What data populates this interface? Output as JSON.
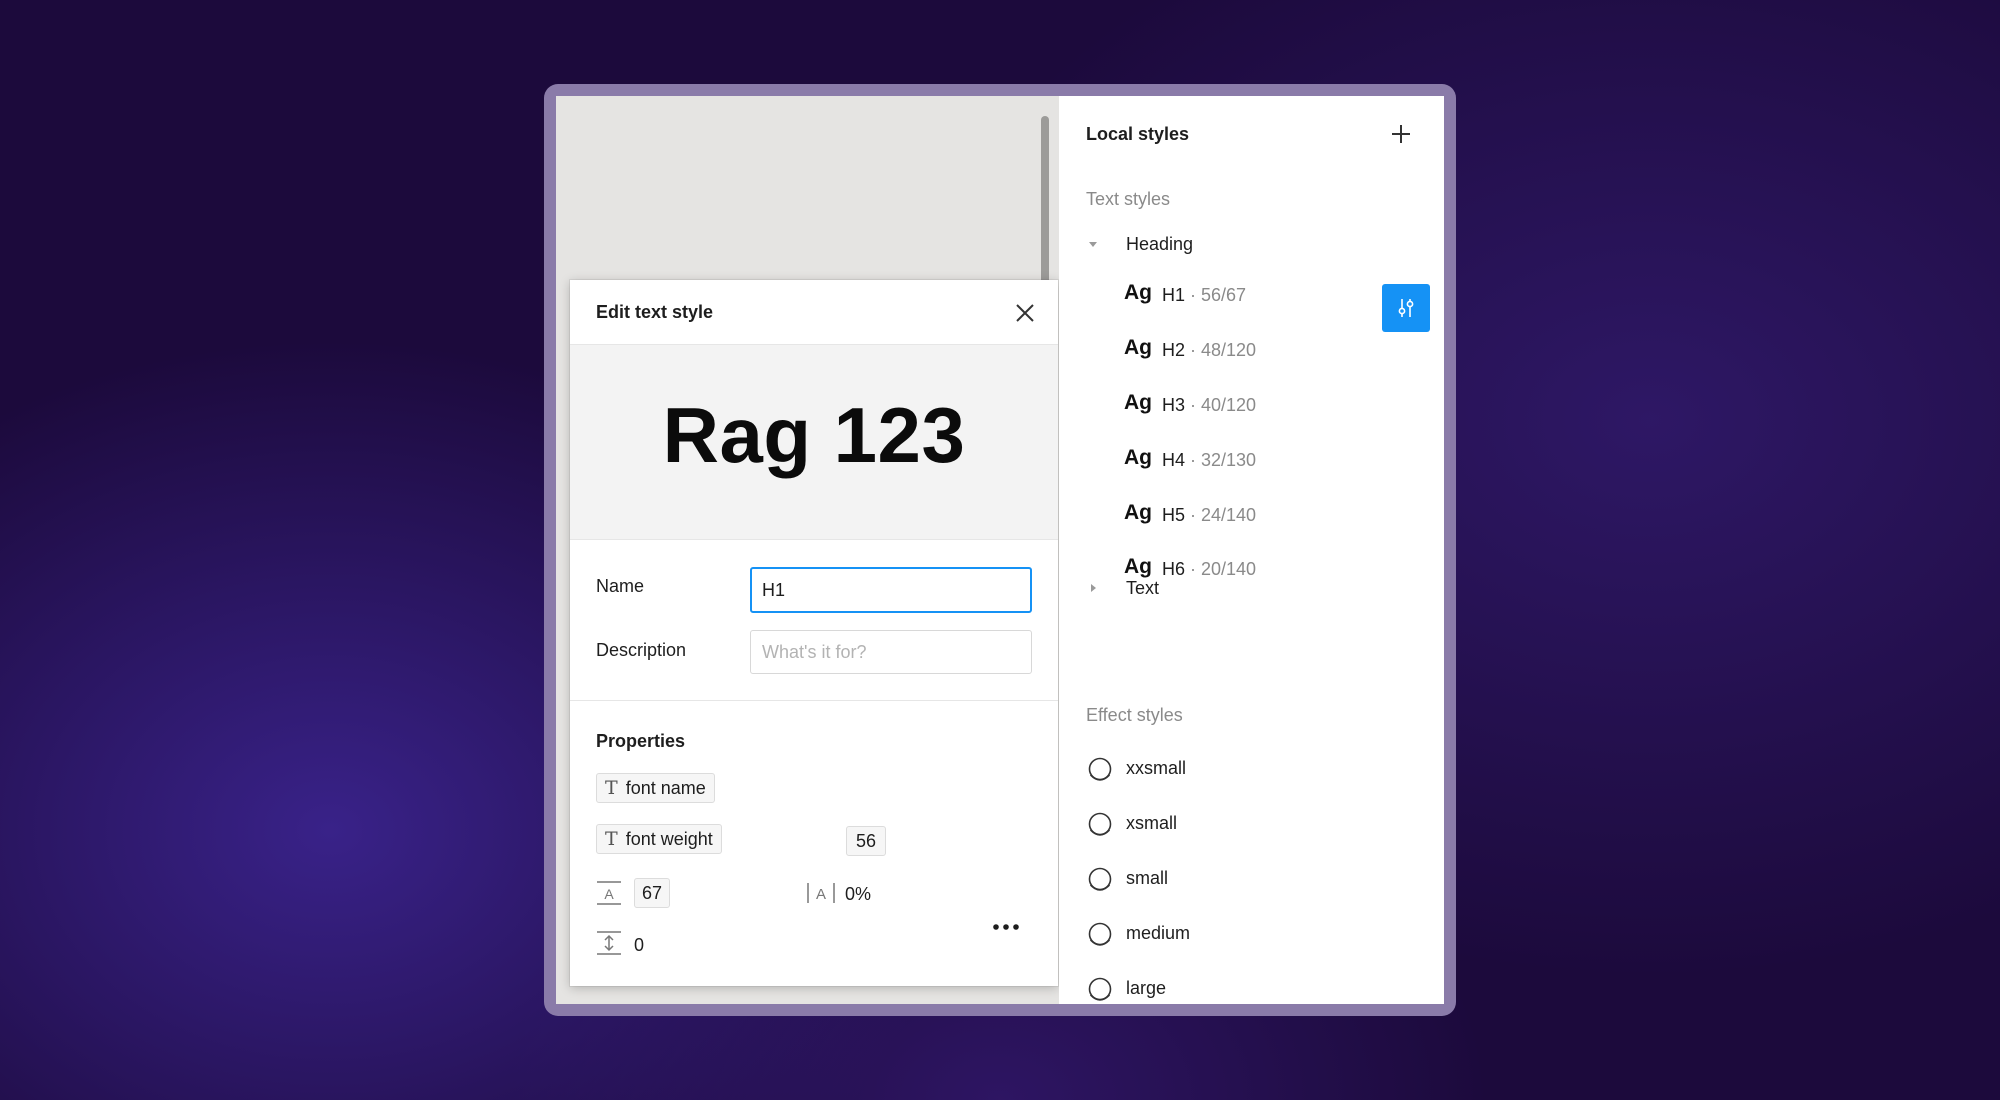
{
  "panel": {
    "title": "Local styles",
    "text_styles_label": "Text styles",
    "heading_group": "Heading",
    "text_group": "Text",
    "text_styles": [
      {
        "ag": "Ag",
        "name": "H1",
        "meta": "· 56/67"
      },
      {
        "ag": "Ag",
        "name": "H2",
        "meta": "· 48/120"
      },
      {
        "ag": "Ag",
        "name": "H3",
        "meta": "· 40/120"
      },
      {
        "ag": "Ag",
        "name": "H4",
        "meta": "· 32/130"
      },
      {
        "ag": "Ag",
        "name": "H5",
        "meta": "· 24/140"
      },
      {
        "ag": "Ag",
        "name": "H6",
        "meta": "· 20/140"
      }
    ],
    "effect_styles_label": "Effect styles",
    "effect_styles": [
      "xxsmall",
      "xsmall",
      "small",
      "medium",
      "large"
    ]
  },
  "modal": {
    "title": "Edit text style",
    "preview": "Rag 123",
    "name_label": "Name",
    "name_value": "H1",
    "description_label": "Description",
    "description_placeholder": "What's it for?",
    "properties_title": "Properties",
    "font_name": "font name",
    "font_weight": "font weight",
    "font_size": "56",
    "line_height": "67",
    "letter_spacing": "0%",
    "paragraph_spacing": "0"
  },
  "colors": {
    "accent": "#1592f5",
    "background": "#1c0a3c",
    "canvas": "#e5e4e2"
  }
}
